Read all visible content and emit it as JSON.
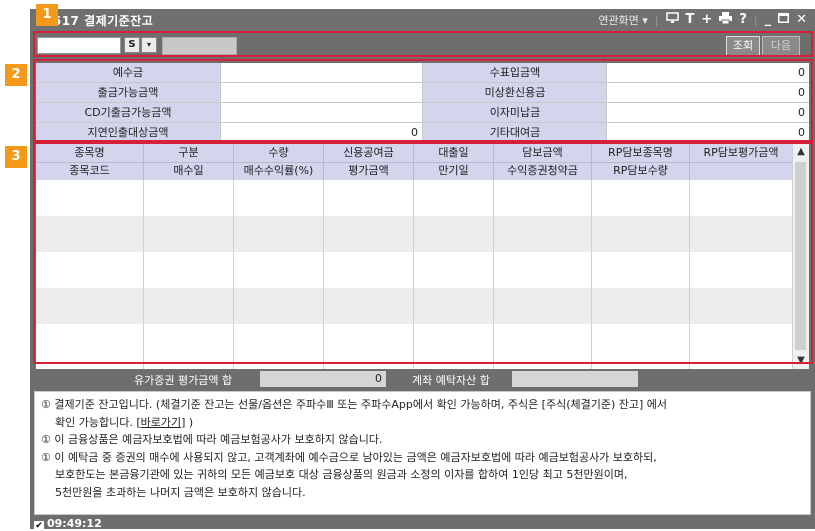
{
  "window": {
    "title": "7517 결제기준잔고",
    "related_screens": "연관화면",
    "icons": [
      "monitor-icon",
      "text-icon",
      "plus-icon",
      "print-icon",
      "help-icon",
      "minimize-icon",
      "maximize-icon",
      "close-icon"
    ]
  },
  "badges": [
    "1",
    "2",
    "3"
  ],
  "toolbar": {
    "s_label": "S",
    "dropdown_glyph": "▾",
    "query_label": "조회",
    "next_label": "다음"
  },
  "summary": {
    "rows": [
      {
        "left_label": "예수금",
        "left_value": "",
        "right_label": "수표입금액",
        "right_value": "0"
      },
      {
        "left_label": "출금가능금액",
        "left_value": "",
        "right_label": "미상환신용금",
        "right_value": "0"
      },
      {
        "left_label": "CD기출금가능금액",
        "left_value": "",
        "right_label": "이자미납금",
        "right_value": "0"
      },
      {
        "left_label": "지연인출대상금액",
        "left_value": "0",
        "right_label": "기타대여금",
        "right_value": "0"
      }
    ]
  },
  "grid": {
    "header_row1": [
      "종목명",
      "구분",
      "수량",
      "신용공여금",
      "대출일",
      "담보금액",
      "RP담보종목명",
      "RP담보평가금액"
    ],
    "header_row2": [
      "종목코드",
      "매수일",
      "매수수익률(%)",
      "평가금액",
      "만기일",
      "수익증권청약금",
      "RP담보수량",
      ""
    ]
  },
  "totals": {
    "securities_label": "유가증권 평가금액 합",
    "securities_value": "0",
    "deposit_label": "계좌 예탁자산 합",
    "deposit_value": ""
  },
  "notes": {
    "n1": "① 결제기준 잔고입니다. (체결기준 잔고는 선물/옵션은 주파수Ⅲ 또는 주파수App에서 확인 가능하며, 주식은 [주식(체결기준) 잔고] 에서",
    "n1b_pre": "확인 가능합니다. ",
    "n1b_link": "[바로가기]",
    "n1b_post": " )",
    "n2": "① 이 금융상품은 예금자보호법에 따라 예금보험공사가 보호하지 않습니다.",
    "n3": "① 이 예탁금 중 증권의 매수에 사용되지 않고, 고객계좌에 예수금으로 남아있는 금액은 예금자보호법에 따라 예금보험공사가 보호하되,",
    "n3b": "보호한도는 본금융기관에 있는 귀하의 모든 예금보호 대상 금융상품의 원금과 소정의 이자를 합하여 1인당 최고 5천만원이며,",
    "n3c": "5천만원을 초과하는 나머지 금액은 보호하지 않습니다."
  },
  "status": {
    "check": "✔",
    "time": "09:49:12"
  }
}
